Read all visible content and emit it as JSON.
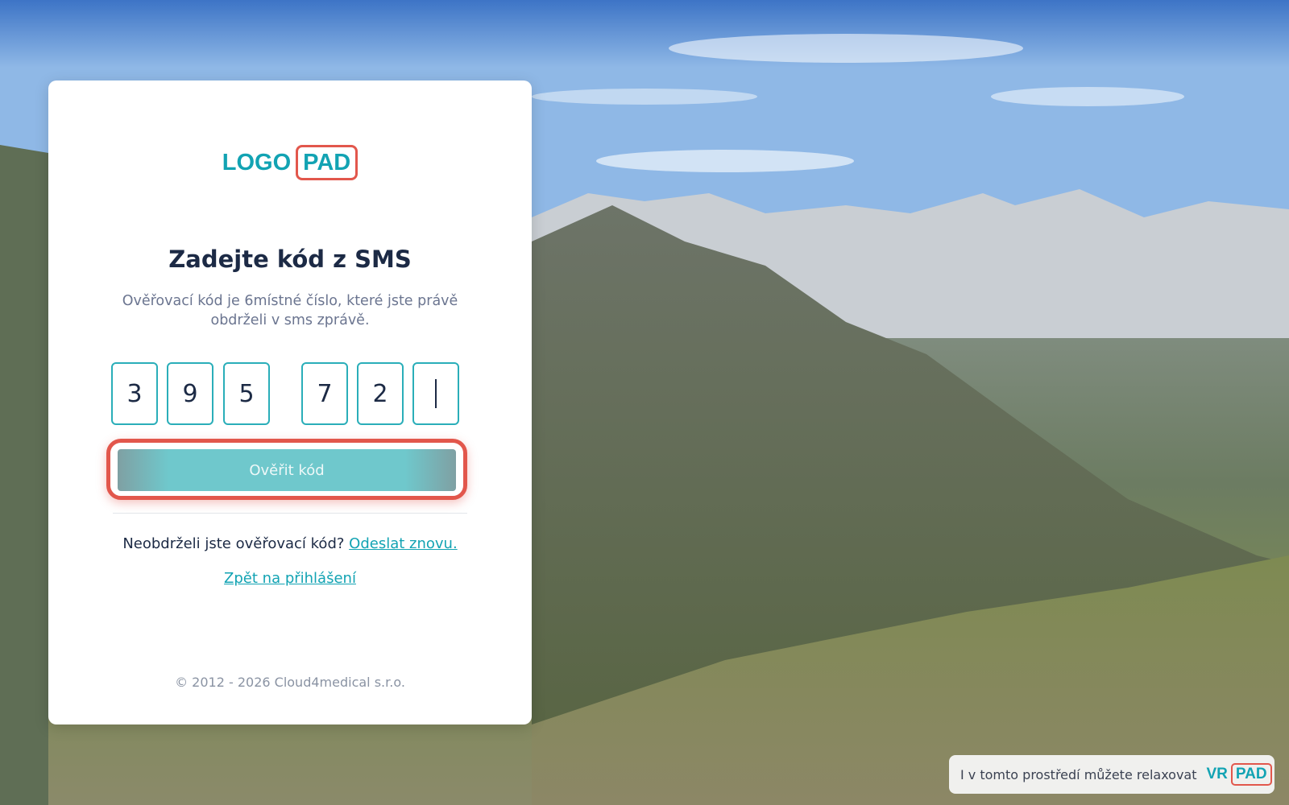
{
  "logo": {
    "left": "LOGO",
    "right": "PAD"
  },
  "heading": "Zadejte kód z SMS",
  "subtitle": "Ověřovací kód je 6místné číslo, které jste právě obdrželi v sms zprávě.",
  "code": {
    "digits": [
      "3",
      "9",
      "5",
      "7",
      "2",
      ""
    ],
    "focused_index": 5
  },
  "verify_button": "Ověřit kód",
  "resend": {
    "question": "Neobdrželi jste ověřovací kód?",
    "link": "Odeslat znovu."
  },
  "back_link": "Zpět na přihlášení",
  "footer": "© 2012 - 2026 Cloud4medical s.r.o.",
  "vr_badge": {
    "text": "I v tomto prostředí můžete relaxovat",
    "logo_left": "VR",
    "logo_right": "PAD"
  },
  "colors": {
    "accent": "#12a3b3",
    "highlight": "#e2574c",
    "heading": "#1c2a45"
  }
}
